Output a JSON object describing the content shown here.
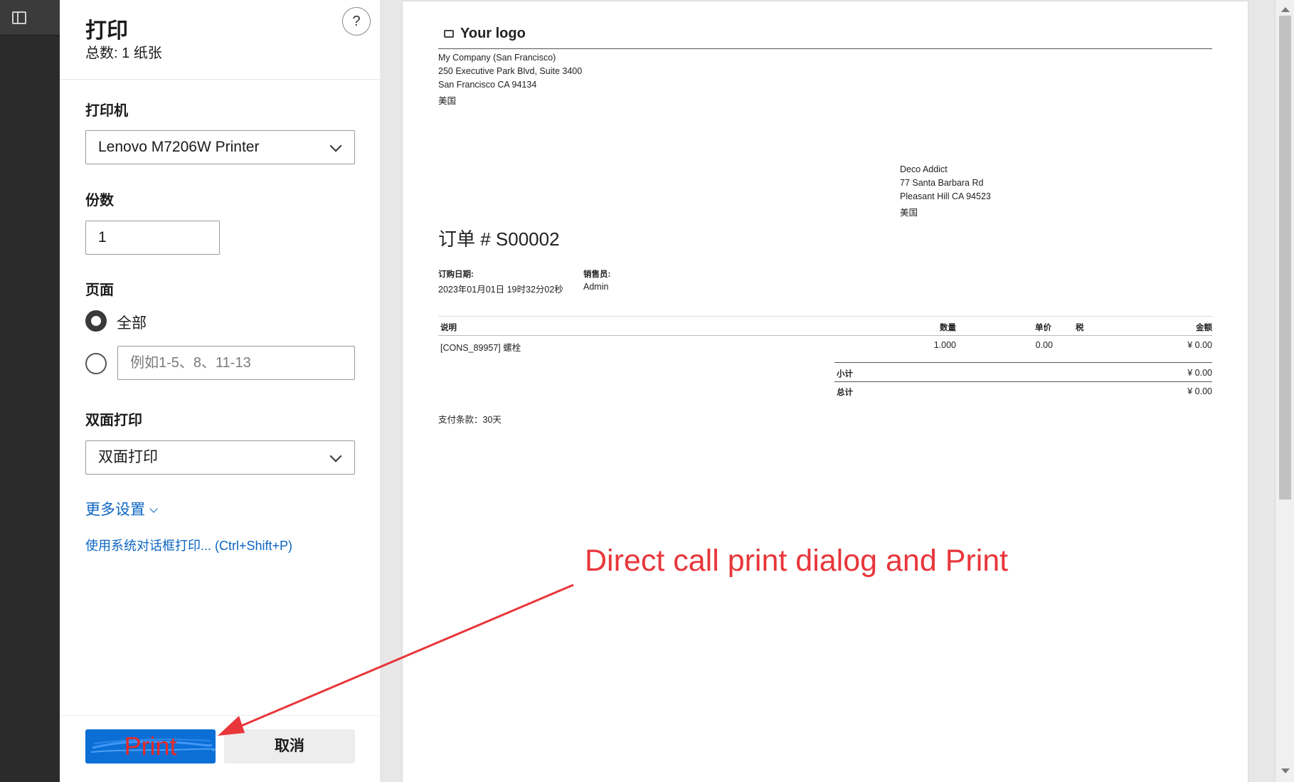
{
  "dialog": {
    "title": "打印",
    "sheet_count": "总数: 1 纸张",
    "help_label": "?"
  },
  "printer": {
    "label": "打印机",
    "selected": "Lenovo M7206W Printer"
  },
  "copies": {
    "label": "份数",
    "value": "1"
  },
  "pages": {
    "label": "页面",
    "all_label": "全部",
    "custom_placeholder": "例如1-5、8、11-13"
  },
  "duplex": {
    "label": "双面打印",
    "selected": "双面打印"
  },
  "links": {
    "more_settings": "更多设置",
    "system_dialog": "使用系统对话框打印... (Ctrl+Shift+P)"
  },
  "buttons": {
    "print": "Print",
    "cancel": "取消"
  },
  "preview": {
    "logo_text": "Your logo",
    "company": {
      "name": "My Company (San Francisco)",
      "street": "250 Executive Park Blvd, Suite 3400",
      "city": "San Francisco CA 94134",
      "country": "美国"
    },
    "customer": {
      "name": "Deco Addict",
      "street": "77 Santa Barbara Rd",
      "city": "Pleasant Hill CA 94523",
      "country": "美国"
    },
    "order_title": "订单 # S00002",
    "order_date_label": "订购日期:",
    "order_date": "2023年01月01日 19时32分02秒",
    "salesperson_label": "销售员:",
    "salesperson": "Admin",
    "columns": {
      "description": "说明",
      "quantity": "数量",
      "unit_price": "单价",
      "tax": "税",
      "amount": "金额"
    },
    "line": {
      "description": "[CONS_89957] 螺栓",
      "quantity": "1.000",
      "unit_price": "0.00",
      "amount": "¥ 0.00"
    },
    "subtotal_label": "小计",
    "subtotal": "¥ 0.00",
    "total_label": "总计",
    "total": "¥ 0.00",
    "payment_terms": "支付条款：30天"
  },
  "annotation": {
    "text": "Direct call print dialog and Print",
    "color": "#e8363a"
  },
  "colors": {
    "accent": "#0b6fd6",
    "link": "#0a64c2"
  }
}
